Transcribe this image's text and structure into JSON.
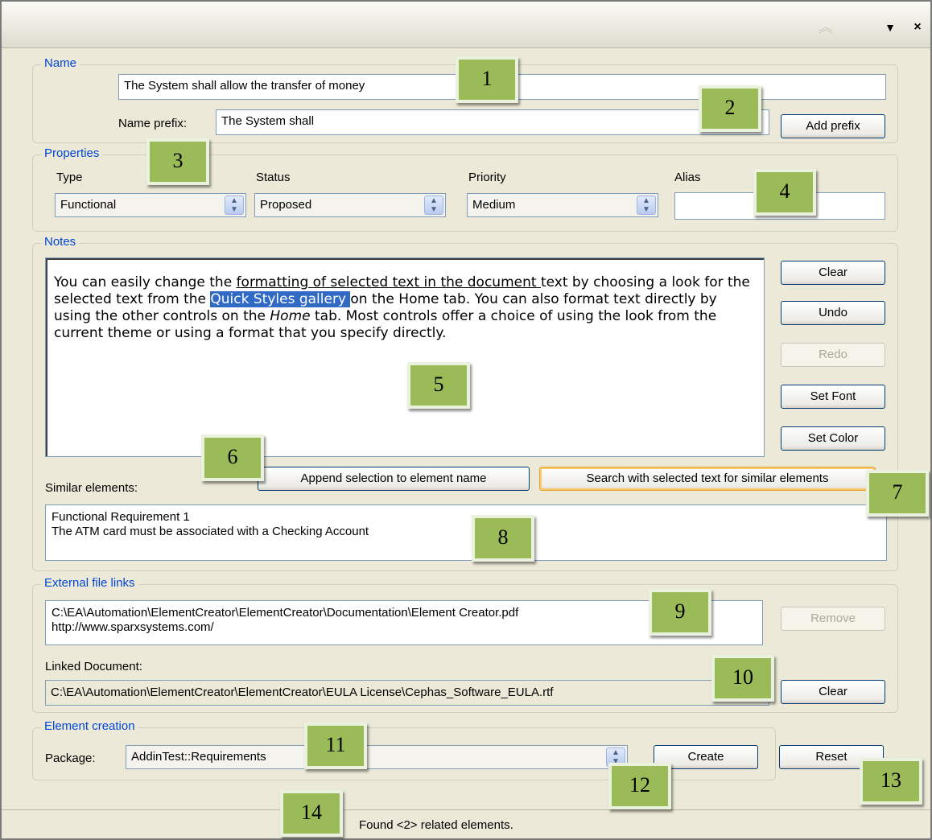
{
  "titlebar": {
    "up_icon": "︽",
    "menu_icon": "▼",
    "close_icon": "×"
  },
  "name_group": {
    "legend": "Name",
    "name_value": "The System shall allow the transfer of money",
    "prefix_label": "Name prefix:",
    "prefix_value": "The System shall",
    "add_prefix": "Add prefix"
  },
  "properties": {
    "legend": "Properties",
    "type_label": "Type",
    "type_value": "Functional",
    "status_label": "Status",
    "status_value": "Proposed",
    "priority_label": "Priority",
    "priority_value": "Medium",
    "alias_label": "Alias",
    "alias_value": ""
  },
  "notes": {
    "legend": "Notes",
    "text_1": "You can easily change the ",
    "text_2": "formatting of selected text in the document ",
    "text_3": "text by choosing a look for the selected text from the ",
    "text_4": "Quick Styles gallery ",
    "text_5": "on the Home tab. You can also format text directly by using the other controls on the ",
    "text_6": "Home",
    "text_7": " tab. Most controls offer a choice of using the look from the current theme or using a format that you specify directly.",
    "clear": "Clear",
    "undo": "Undo",
    "redo": "Redo",
    "set_font": "Set Font",
    "set_color": "Set Color",
    "append": "Append selection to element name",
    "search": "Search with selected text for similar elements",
    "similar_label": "Similar elements:",
    "similar_items": [
      "Functional Requirement 1",
      "The ATM card must be associated with a Checking Account"
    ]
  },
  "external": {
    "legend": "External file links",
    "links": [
      "C:\\EA\\Automation\\ElementCreator\\ElementCreator\\Documentation\\Element Creator.pdf",
      "http://www.sparxsystems.com/"
    ],
    "remove": "Remove",
    "linked_label": "Linked Document:",
    "linked_value": "C:\\EA\\Automation\\ElementCreator\\ElementCreator\\EULA License\\Cephas_Software_EULA.rtf",
    "clear": "Clear"
  },
  "creation": {
    "legend": "Element creation",
    "package_label": "Package:",
    "package_value": "AddinTest::Requirements",
    "create": "Create",
    "reset": "Reset"
  },
  "status": {
    "text": "Found <2> related elements."
  },
  "callouts": [
    "1",
    "2",
    "3",
    "4",
    "5",
    "6",
    "7",
    "8",
    "9",
    "10",
    "11",
    "12",
    "13",
    "14"
  ]
}
